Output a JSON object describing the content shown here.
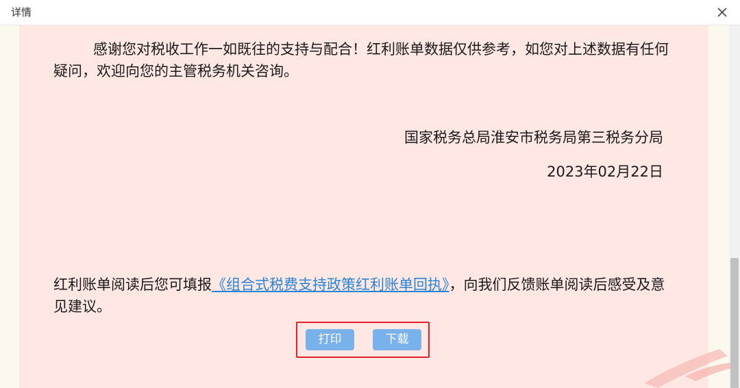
{
  "window": {
    "title": "详情",
    "close_icon": "close-icon"
  },
  "letter": {
    "thanks_paragraph": "感谢您对税收工作一如既往的支持与配合！红利账单数据仅供参考，如您对上述数据有任何疑问，欢迎向您的主管税务机关咨询。",
    "issuer": "国家税务总局淮安市税务局第三税务分局",
    "date": "2023年02月22日",
    "feedback_prefix": "红利账单阅读后您可填报",
    "feedback_link": "《组合式税费支持政策红利账单回执》",
    "feedback_suffix": "，向我们反馈账单阅读后感受及意见建议。"
  },
  "actions": {
    "print_label": "打印",
    "download_label": "下载"
  },
  "colors": {
    "sheet_background": "#ffe8e4",
    "button": "#79b1ea",
    "link": "#2a84d6",
    "highlight_border": "#e8202a"
  }
}
